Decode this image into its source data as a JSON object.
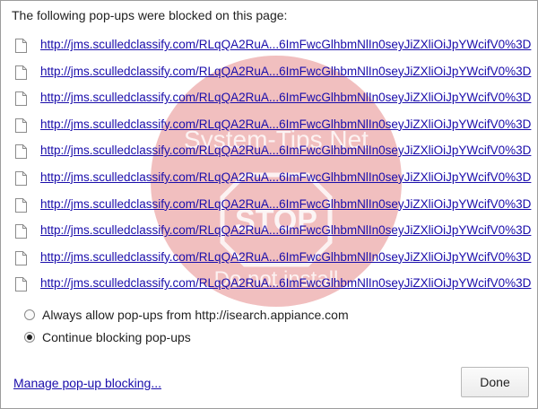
{
  "dialog": {
    "heading": "The following pop-ups were blocked on this page:",
    "links": [
      "http://jms.sculledclassify.com/RLqQA2RuA...6ImFwcGlhbmNlIn0seyJiZXliOiJpYWcifV0%3D",
      "http://jms.sculledclassify.com/RLqQA2RuA...6ImFwcGlhbmNlIn0seyJiZXliOiJpYWcifV0%3D",
      "http://jms.sculledclassify.com/RLqQA2RuA...6ImFwcGlhbmNlIn0seyJiZXliOiJpYWcifV0%3D",
      "http://jms.sculledclassify.com/RLqQA2RuA...6ImFwcGlhbmNlIn0seyJiZXliOiJpYWcifV0%3D",
      "http://jms.sculledclassify.com/RLqQA2RuA...6ImFwcGlhbmNlIn0seyJiZXliOiJpYWcifV0%3D",
      "http://jms.sculledclassify.com/RLqQA2RuA...6ImFwcGlhbmNlIn0seyJiZXliOiJpYWcifV0%3D",
      "http://jms.sculledclassify.com/RLqQA2RuA...6ImFwcGlhbmNlIn0seyJiZXliOiJpYWcifV0%3D",
      "http://jms.sculledclassify.com/RLqQA2RuA...6ImFwcGlhbmNlIn0seyJiZXliOiJpYWcifV0%3D",
      "http://jms.sculledclassify.com/RLqQA2RuA...6ImFwcGlhbmNlIn0seyJiZXliOiJpYWcifV0%3D",
      "http://jms.sculledclassify.com/RLqQA2RuA...6ImFwcGlhbmNlIn0seyJiZXliOiJpYWcifV0%3D"
    ],
    "options": [
      {
        "label": "Always allow pop-ups from http://isearch.appiance.com",
        "checked": false
      },
      {
        "label": "Continue blocking pop-ups",
        "checked": true
      }
    ],
    "manage_label": "Manage pop-up blocking...",
    "done_label": "Done"
  },
  "watermark": {
    "line1": "System-Tips.Net",
    "stop": "STOP",
    "line2": "Do not install"
  },
  "colors": {
    "link": "#1a0dab",
    "watermark": "#d9534f"
  },
  "icons": {
    "row_icon": "page-icon"
  }
}
